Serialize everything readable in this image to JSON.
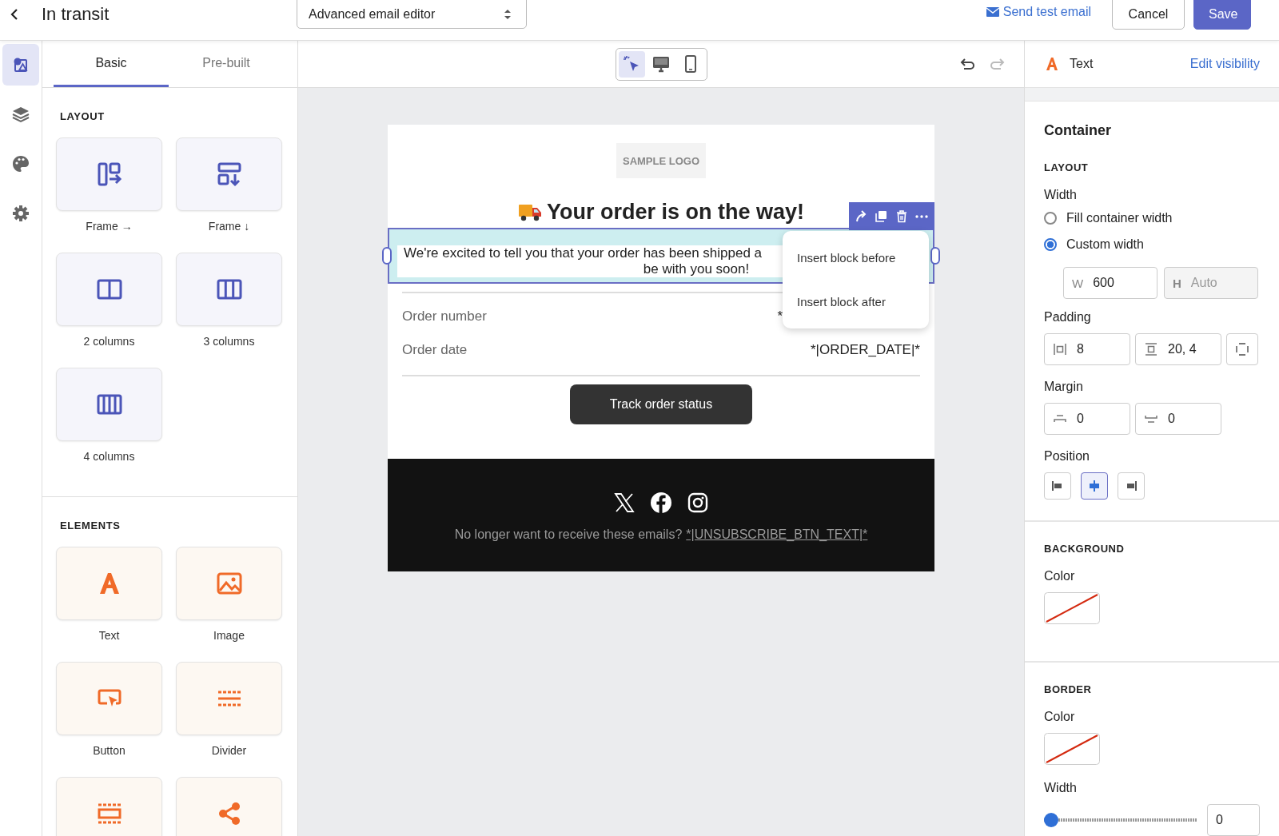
{
  "header": {
    "title": "In transit",
    "editor_select": "Advanced email editor",
    "send_test": "Send test email",
    "buttons": [
      {
        "label": "Cancel",
        "kind": "secondary"
      },
      {
        "label": "Save",
        "kind": "primary"
      }
    ]
  },
  "rail": [
    {
      "kind": "elements",
      "selected": true
    },
    {
      "kind": "layers",
      "selected": false
    },
    {
      "kind": "theme",
      "selected": false
    },
    {
      "kind": "settings",
      "selected": false
    }
  ],
  "library": {
    "tabs": [
      {
        "label": "Basic",
        "selected": true
      },
      {
        "label": "Pre-built",
        "selected": false
      }
    ],
    "sections": [
      {
        "heading": "LAYOUT",
        "items": [
          {
            "label": "Frame →",
            "kind": "frame-right"
          },
          {
            "label": "Frame ↓",
            "kind": "frame-down"
          },
          {
            "label": "2 columns",
            "kind": "columns-2"
          },
          {
            "label": "3 columns",
            "kind": "columns-3"
          },
          {
            "label": "4 columns",
            "kind": "columns-4"
          }
        ]
      },
      {
        "heading": "ELEMENTS",
        "items": [
          {
            "label": "Text",
            "kind": "text"
          },
          {
            "label": "Image",
            "kind": "image"
          },
          {
            "label": "Button",
            "kind": "button"
          },
          {
            "label": "Divider",
            "kind": "divider"
          },
          {
            "kind": "spacer"
          },
          {
            "kind": "social"
          }
        ]
      }
    ]
  },
  "canvas": {
    "view_modes": [
      {
        "kind": "select",
        "selected": true
      },
      {
        "kind": "desktop",
        "selected": false
      },
      {
        "kind": "mobile",
        "selected": false
      }
    ],
    "history": [
      {
        "kind": "undo",
        "disabled": false
      },
      {
        "kind": "redo",
        "disabled": true
      }
    ]
  },
  "email": {
    "logo": "SAMPLE LOGO",
    "heading": "Your order is on the way!",
    "intro_line_1": "We're excited to tell you that your order has been shipped a",
    "intro_line_2": "be with you soon!",
    "details": [
      {
        "label": "Order number",
        "value": "*"
      },
      {
        "label": "Order date",
        "value": "*|ORDER_DATE|*"
      }
    ],
    "cta": "Track order status",
    "footer": {
      "social": [
        {
          "kind": "x"
        },
        {
          "kind": "facebook"
        },
        {
          "kind": "instagram"
        }
      ],
      "text": "No longer want to receive these emails?",
      "link": "*|UNSUBSCRIBE_BTN_TEXT|*"
    }
  },
  "block_toolbar": [
    {
      "kind": "move"
    },
    {
      "kind": "duplicate"
    },
    {
      "kind": "delete"
    },
    {
      "kind": "more"
    }
  ],
  "context_menu": [
    "Insert block before",
    "Insert block after"
  ],
  "inspector": {
    "header": {
      "label": "Text",
      "link": "Edit visibility"
    },
    "container": {
      "title": "Container",
      "layout_heading": "LAYOUT",
      "width_label": "Width",
      "width_options": [
        {
          "label": "Fill container width",
          "selected": false
        },
        {
          "label": "Custom width",
          "selected": true
        }
      ],
      "size_fields": [
        {
          "prefix": "W",
          "value": "600",
          "disabled": false
        },
        {
          "prefix": "H",
          "value": "Auto",
          "disabled": true
        }
      ],
      "padding_label": "Padding",
      "padding_fields": [
        {
          "kind": "horizontal",
          "value": "8"
        },
        {
          "kind": "vertical",
          "value": "20, 4"
        }
      ],
      "margin_label": "Margin",
      "margin_fields": [
        {
          "kind": "top",
          "value": "0"
        },
        {
          "kind": "bottom",
          "value": "0"
        }
      ],
      "position_label": "Position",
      "positions": [
        {
          "kind": "left",
          "selected": false
        },
        {
          "kind": "center",
          "selected": true
        },
        {
          "kind": "right",
          "selected": false
        }
      ]
    },
    "background": {
      "heading": "BACKGROUND",
      "color_label": "Color"
    },
    "border": {
      "heading": "BORDER",
      "color_label": "Color",
      "width_label": "Width",
      "width": {
        "level": 0,
        "value": "0"
      }
    }
  }
}
